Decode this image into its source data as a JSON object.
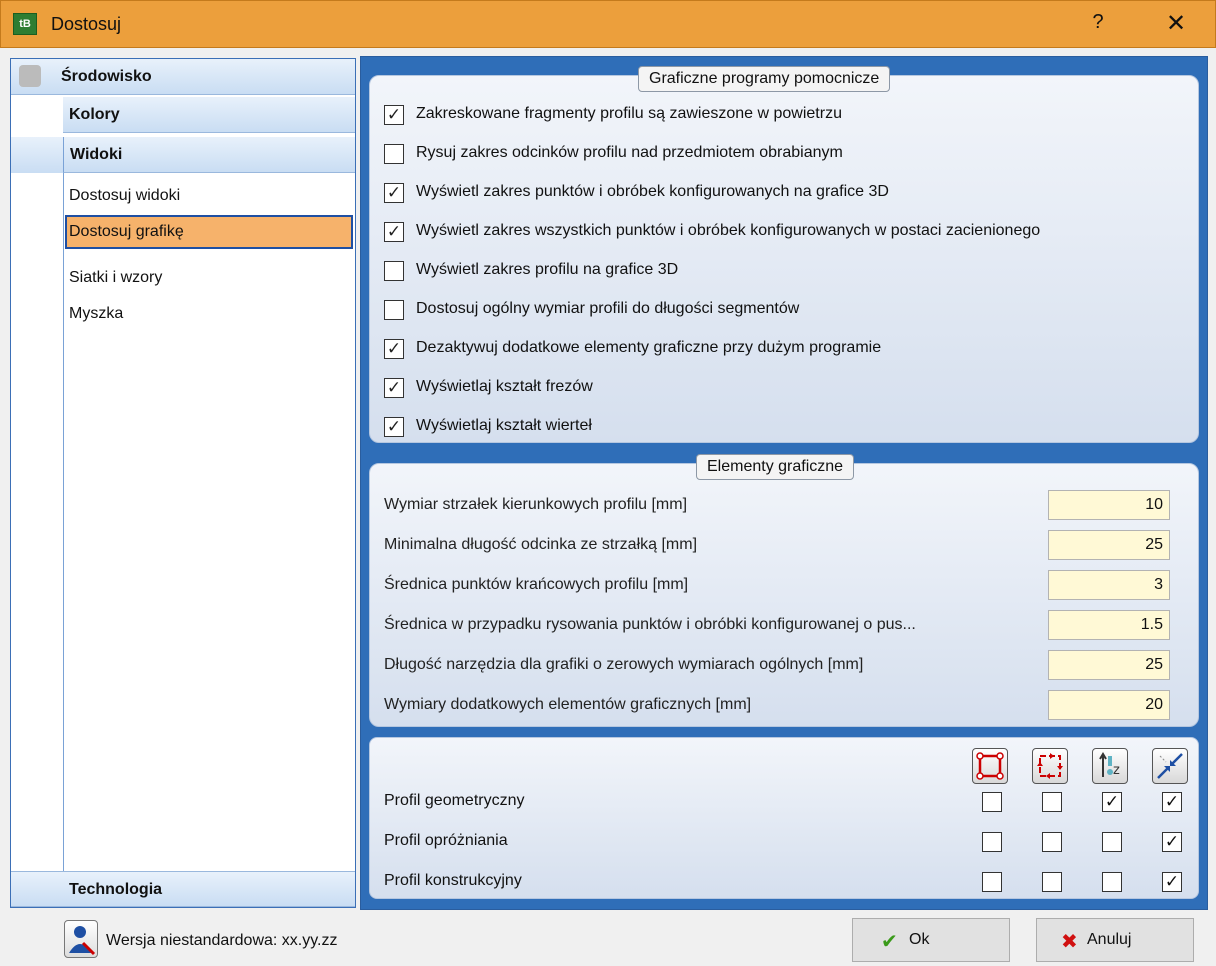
{
  "window": {
    "title": "Dostosuj",
    "help_label": "?",
    "close_label": "✕",
    "app_icon_text": "tB"
  },
  "nav": {
    "environment_label": "Środowisko",
    "colors_label": "Kolory",
    "views_label": "Widoki",
    "items": [
      "Dostosuj widoki",
      "Dostosuj grafikę",
      "Siatki i wzory",
      "Myszka"
    ],
    "selected": "Dostosuj grafikę",
    "technology_label": "Technologia"
  },
  "aux": {
    "legend": "Graficzne programy pomocnicze",
    "items": [
      {
        "label": "Zakreskowane fragmenty profilu są zawieszone w powietrzu",
        "checked": true
      },
      {
        "label": "Rysuj zakres odcinków profilu nad przedmiotem obrabianym",
        "checked": false
      },
      {
        "label": "Wyświetl zakres punktów i obróbek konfigurowanych na grafice 3D",
        "checked": true
      },
      {
        "label": "Wyświetl zakres wszystkich punktów i obróbek konfigurowanych w postaci zacienionego",
        "checked": true
      },
      {
        "label": "Wyświetl zakres profilu na grafice 3D",
        "checked": false
      },
      {
        "label": "Dostosuj ogólny wymiar profili do długości segmentów",
        "checked": false
      },
      {
        "label": "Dezaktywuj dodatkowe elementy graficzne przy dużym programie",
        "checked": true
      },
      {
        "label": "Wyświetlaj kształt frezów",
        "checked": true
      },
      {
        "label": "Wyświetlaj kształt wierteł",
        "checked": true
      }
    ]
  },
  "elements": {
    "legend": "Elementy graficzne",
    "fields": [
      {
        "label": "Wymiar strzałek kierunkowych profilu [mm]",
        "value": "10"
      },
      {
        "label": "Minimalna długość odcinka ze strzałką [mm]",
        "value": "25"
      },
      {
        "label": "Średnica punktów krańcowych profilu [mm]",
        "value": "3"
      },
      {
        "label": "Średnica w przypadku rysowania punktów i obróbki konfigurowanej o pus...",
        "value": "1.5"
      },
      {
        "label": "Długość narzędzia dla grafiki o zerowych wymiarach ogólnych [mm]",
        "value": "25"
      },
      {
        "label": "Wymiary dodatkowych elementów graficznych [mm]",
        "value": "20"
      }
    ]
  },
  "profiles": {
    "columns": [
      "profile-points-icon",
      "profile-arrows-icon",
      "tool-z-icon",
      "arrows-converge-icon"
    ],
    "rows": [
      {
        "label": "Profil geometryczny",
        "checks": [
          false,
          false,
          true,
          true
        ]
      },
      {
        "label": "Profil opróżniania",
        "checks": [
          false,
          false,
          false,
          true
        ]
      },
      {
        "label": "Profil konstrukcyjny",
        "checks": [
          false,
          false,
          false,
          true
        ]
      }
    ]
  },
  "footer": {
    "version_label": "Wersja niestandardowa: xx.yy.zz",
    "ok_label": "Ok",
    "cancel_label": "Anuluj"
  }
}
